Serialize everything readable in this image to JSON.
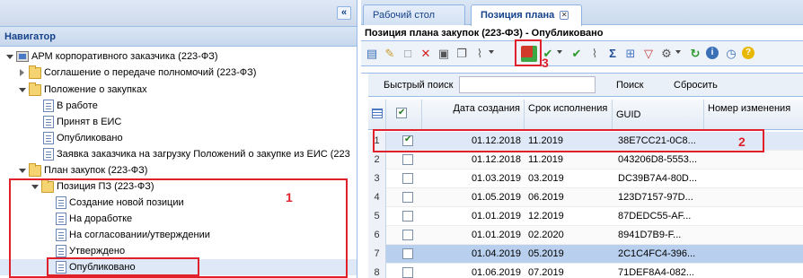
{
  "navigator": {
    "title": "Навигатор",
    "collapse_icon": "«",
    "tree": [
      {
        "label": "АРМ корпоративного заказчика (223-ФЗ)",
        "icon": "app-icon"
      },
      {
        "label": "Соглашение о передаче полномочий (223-ФЗ)",
        "icon": "folder-icon"
      },
      {
        "label": "Положение о закупках",
        "icon": "folder-icon"
      },
      {
        "label": "В работе",
        "icon": "document-icon"
      },
      {
        "label": "Принят в ЕИС",
        "icon": "document-icon"
      },
      {
        "label": "Опубликовано",
        "icon": "document-icon"
      },
      {
        "label": "Заявка заказчика на загрузку Положений о закупке из ЕИС (223",
        "icon": "document-icon"
      },
      {
        "label": "План закупок (223-ФЗ)",
        "icon": "folder-icon"
      },
      {
        "label": "Позиция ПЗ (223-ФЗ)",
        "icon": "folder-icon"
      },
      {
        "label": "Создание новой позиции",
        "icon": "document-icon"
      },
      {
        "label": "На доработке",
        "icon": "document-icon"
      },
      {
        "label": "На согласовании/утверждении",
        "icon": "document-icon"
      },
      {
        "label": "Утверждено",
        "icon": "document-icon"
      },
      {
        "label": "Опубликовано",
        "icon": "document-icon"
      }
    ]
  },
  "annotations": {
    "n1": "1",
    "n2": "2",
    "n3": "3",
    "color": "#e0202a"
  },
  "tabs": [
    {
      "label": "Рабочий стол",
      "active": false
    },
    {
      "label": "Позиция плана",
      "active": true,
      "close": "✕"
    }
  ],
  "panel_title": "Позиция плана закупок (223-ФЗ) - Опубликовано",
  "toolbar_icons": [
    "new-icon",
    "edit-icon",
    "blank-icon",
    "delete-icon",
    "print-icon",
    "copy-icon",
    "attach-icon",
    "publish-icon",
    "approve-icon",
    "approve-cancel-icon",
    "attach-icon",
    "sum-icon",
    "filter-icon",
    "settings-icon",
    "refresh-icon",
    "info-icon",
    "history-icon",
    "help-icon"
  ],
  "search": {
    "label": "Быстрый поиск",
    "value": "",
    "search_button": "Поиск",
    "reset_button": "Сбросить"
  },
  "grid": {
    "columns": [
      "",
      "",
      "Дата создания",
      "Срок исполнения",
      "GUID",
      "Номер изменения"
    ],
    "rows": [
      {
        "n": "1",
        "checked": true,
        "date": "01.12.2018",
        "term": "11.2019",
        "guid": "38E7CC21-0C8..."
      },
      {
        "n": "2",
        "checked": false,
        "date": "01.12.2018",
        "term": "11.2019",
        "guid": "043206D8-5553..."
      },
      {
        "n": "3",
        "checked": false,
        "date": "01.03.2019",
        "term": "03.2019",
        "guid": "DC39B7A4-80D..."
      },
      {
        "n": "4",
        "checked": false,
        "date": "01.05.2019",
        "term": "06.2019",
        "guid": "123D7157-97D..."
      },
      {
        "n": "5",
        "checked": false,
        "date": "01.01.2019",
        "term": "12.2019",
        "guid": "87DEDC55-AF..."
      },
      {
        "n": "6",
        "checked": false,
        "date": "01.01.2019",
        "term": "02.2020",
        "guid": "8941D7B9-F..."
      },
      {
        "n": "7",
        "checked": false,
        "date": "01.04.2019",
        "term": "05.2019",
        "guid": "2C1C4FC4-396..."
      },
      {
        "n": "8",
        "checked": false,
        "date": "01.06.2019",
        "term": "07.2019",
        "guid": "71DEF8A4-082..."
      }
    ]
  }
}
